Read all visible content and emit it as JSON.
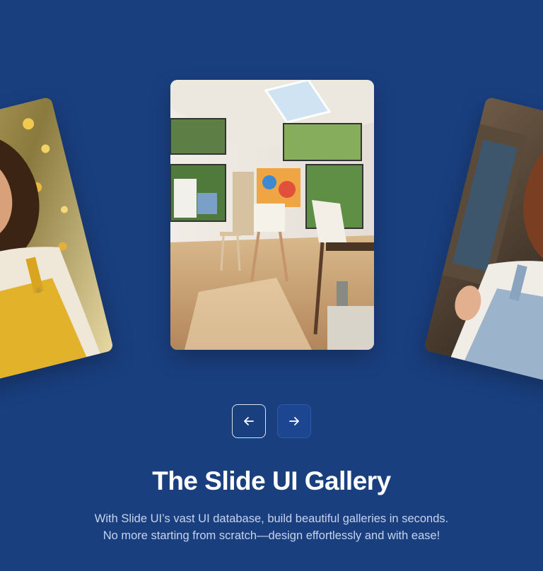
{
  "gallery": {
    "cards": [
      {
        "position": "left",
        "image": "woman-yellow-overalls-portrait"
      },
      {
        "position": "center",
        "image": "sunlit-art-studio"
      },
      {
        "position": "right",
        "image": "woman-denim-overalls-portrait"
      }
    ]
  },
  "navigation": {
    "prev_icon": "arrow-left-icon",
    "next_icon": "arrow-right-icon"
  },
  "heading": {
    "title": "The Slide UI Gallery",
    "description_line1": "With Slide UI’s vast UI database, build beautiful galleries in seconds.",
    "description_line2": "No more starting from scratch—design effortlessly and with ease!"
  },
  "colors": {
    "background": "#1a3f7f",
    "title": "#ffffff",
    "description": "#c6d3ee"
  }
}
